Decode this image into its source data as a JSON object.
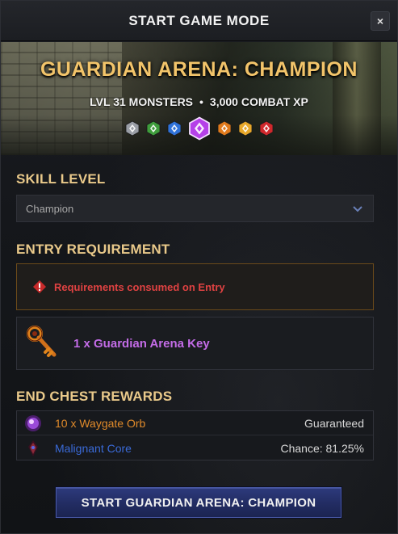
{
  "window": {
    "title": "START GAME MODE",
    "close_label": "×"
  },
  "banner": {
    "title": "GUARDIAN ARENA: CHAMPION",
    "monsters": "LVL 31 MONSTERS",
    "separator": "•",
    "xp": "3,000 COMBAT XP",
    "tier_gems": [
      {
        "name": "gray-tier-gem-icon",
        "color": "#9a9ea6",
        "selected": false
      },
      {
        "name": "green-tier-gem-icon",
        "color": "#3f9d3c",
        "selected": false
      },
      {
        "name": "blue-tier-gem-icon",
        "color": "#2f72d8",
        "selected": false
      },
      {
        "name": "purple-tier-gem-icon",
        "color": "#b540e8",
        "selected": true
      },
      {
        "name": "orange-tier-gem-icon",
        "color": "#e07a1c",
        "selected": false
      },
      {
        "name": "gold-tier-gem-icon",
        "color": "#e8a82a",
        "selected": false
      },
      {
        "name": "red-tier-gem-icon",
        "color": "#d0282c",
        "selected": false
      }
    ]
  },
  "skill_level": {
    "label": "SKILL LEVEL",
    "selected": "Champion"
  },
  "entry_requirement": {
    "label": "ENTRY REQUIREMENT",
    "warning": "Requirements consumed on Entry",
    "item": "1 x Guardian Arena Key",
    "item_color": "#c46ce8"
  },
  "rewards": {
    "label": "END CHEST REWARDS",
    "items": [
      {
        "name": "10 x Waygate Orb",
        "color": "#e08a2a",
        "status": "Guaranteed",
        "icon": "waygate-orb-icon"
      },
      {
        "name": "Malignant Core",
        "color": "#3a6ad8",
        "status": "Chance: 81.25%",
        "icon": "malignant-core-icon"
      }
    ]
  },
  "start_button": {
    "label": "START GUARDIAN ARENA: CHAMPION"
  },
  "colors": {
    "section_label": "#e9c98a",
    "banner_title": "#f2c46a",
    "warning_text": "#e04242",
    "button_blue": "#222c62"
  }
}
